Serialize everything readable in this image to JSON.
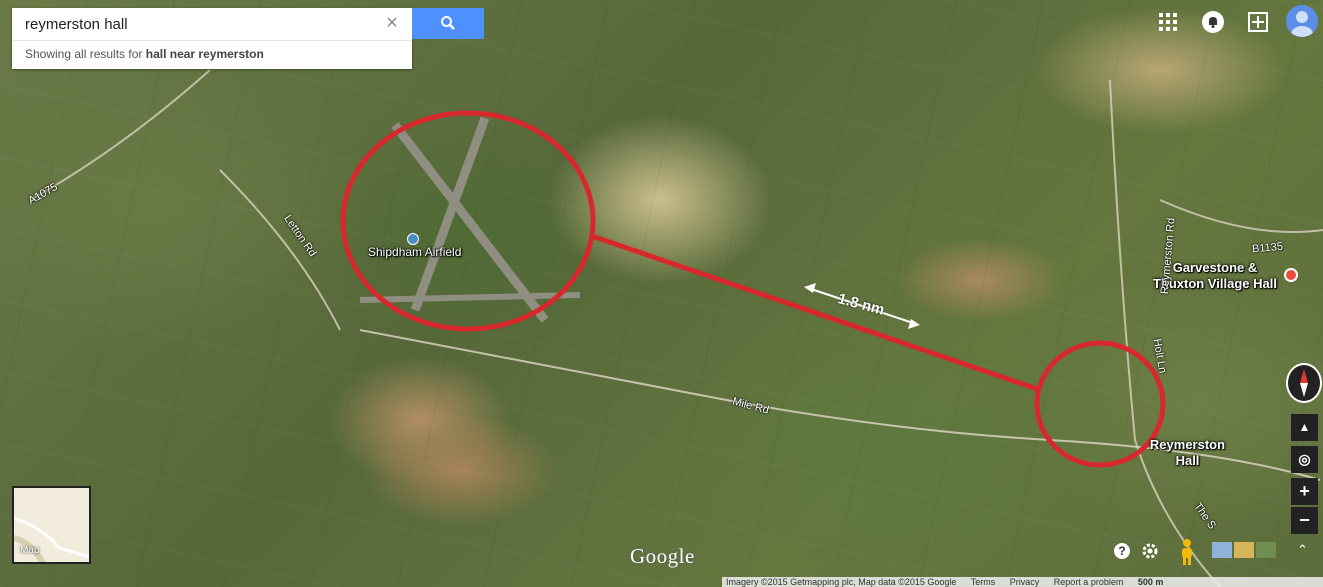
{
  "search": {
    "query": "reymerston hall",
    "results_prefix": "Showing all results for",
    "results_query": "hall near reymerston"
  },
  "places": {
    "airfield": "Shipdham Airfield",
    "hall_line1": "Reymerston",
    "hall_line2": "Hall",
    "garvestone_line1": "Garvestone &",
    "garvestone_line2": "Thuxton Village Hall"
  },
  "roads": {
    "a1075": "A1075",
    "letton": "Letton Rd",
    "mile": "Mile Rd",
    "holt": "Holt Ln",
    "reymerston_rd": "Reymerston Rd",
    "b1135": "B1135",
    "the_s": "The S"
  },
  "annotation": {
    "distance": "1.8 nm",
    "circle_color": "#d9272e"
  },
  "controls": {
    "minimap_label": "Map",
    "help": "?",
    "zoom_in": "+",
    "zoom_out": "−"
  },
  "branding": {
    "logo": "Google"
  },
  "footer": {
    "imagery": "Imagery ©2015 Getmapping plc, Map data ©2015 Google",
    "terms": "Terms",
    "privacy": "Privacy",
    "report": "Report a problem",
    "scale": "500 m"
  }
}
